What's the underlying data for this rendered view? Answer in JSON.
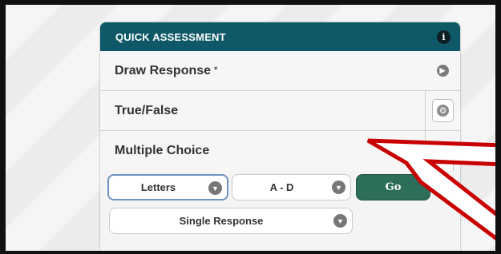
{
  "panel": {
    "title": "QUICK ASSESSMENT",
    "info_icon": "i",
    "items": [
      {
        "label": "Draw Response",
        "suffix": " *"
      },
      {
        "label": "True/False"
      },
      {
        "label": "Multiple Choice"
      }
    ]
  },
  "controls": {
    "label_type": "Letters",
    "range": "A - D",
    "go_label": "Go",
    "response_mode": "Single Response"
  },
  "colors": {
    "header_bg": "#0f5867",
    "go_bg": "#2d6e5b",
    "arrow": "#c90000"
  }
}
